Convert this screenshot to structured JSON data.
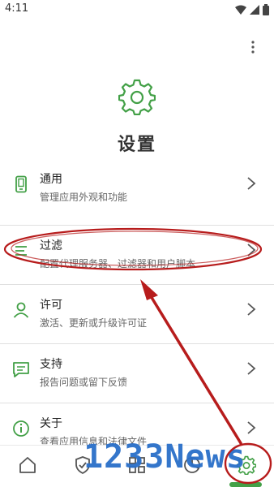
{
  "status_bar": {
    "time": "4:11"
  },
  "header": {
    "title": "设置",
    "menu_icon": "more-vert-icon",
    "hero_icon": "gear-icon"
  },
  "settings_items": [
    {
      "title": "通用",
      "subtitle": "管理应用外观和功能",
      "icon": "phone-icon"
    },
    {
      "title": "过滤",
      "subtitle": "配置代理服务器、过滤器和用户脚本",
      "icon": "filter-lines-icon"
    },
    {
      "title": "许可",
      "subtitle": "激活、更新或升级许可证",
      "icon": "person-icon"
    },
    {
      "title": "支持",
      "subtitle": "报告问题或留下反馈",
      "icon": "chat-icon"
    },
    {
      "title": "关于",
      "subtitle": "查看应用信息和法律文件",
      "icon": "info-icon"
    }
  ],
  "bottom_nav": [
    {
      "name": "home",
      "icon": "home-icon"
    },
    {
      "name": "protection",
      "icon": "shield-icon"
    },
    {
      "name": "activity",
      "icon": "grid-icon"
    },
    {
      "name": "statistics",
      "icon": "chart-icon"
    },
    {
      "name": "settings",
      "icon": "gear-icon",
      "active": true
    }
  ],
  "watermark": "1233News",
  "colors": {
    "accent": "#43a047",
    "annotation": "#b71c1c",
    "watermark": "#2a6fc9"
  }
}
